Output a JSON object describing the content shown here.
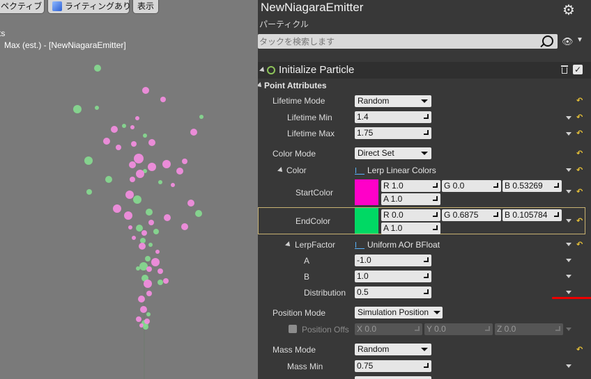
{
  "viewport": {
    "toolbar": {
      "perspective_label": "ペクティブ",
      "lighting_label": "ライティングあり",
      "show_label": "表示"
    },
    "stats_line1": "ts",
    "stats_line2": "Max (est.) - [NewNiagaraEmitter]",
    "particle_colors": {
      "pink": "#f38de0",
      "green": "#86d98f"
    }
  },
  "panel": {
    "title": "NewNiagaraEmitter",
    "subtitle": "パーティクル",
    "search": {
      "placeholder": "タックを検索します"
    },
    "module": {
      "title": "Initialize Particle",
      "section": "Point Attributes",
      "rows": {
        "lifetime_mode": {
          "label": "Lifetime Mode",
          "value": "Random"
        },
        "lifetime_min": {
          "label": "Lifetime Min",
          "value": "1.4"
        },
        "lifetime_max": {
          "label": "Lifetime Max",
          "value": "1.75"
        },
        "color_mode": {
          "label": "Color Mode",
          "value": "Direct Set"
        },
        "color": {
          "label": "Color",
          "value": "Lerp Linear Colors"
        },
        "start_color": {
          "label": "StartColor",
          "r": "R 1.0",
          "g": "G 0.0",
          "b": "B 0.53269",
          "a": "A 1.0",
          "swatch": "#ff00c8"
        },
        "end_color": {
          "label": "EndColor",
          "r": "R 0.0",
          "g": "G 0.6875",
          "b": "B 0.105784",
          "a": "A 1.0",
          "swatch": "#00d964"
        },
        "lerp_factor": {
          "label": "LerpFactor",
          "value": "Uniform AOr BFloat"
        },
        "a": {
          "label": "A",
          "value": "-1.0"
        },
        "b": {
          "label": "B",
          "value": "1.0"
        },
        "distribution": {
          "label": "Distribution",
          "value": "0.5"
        },
        "position_mode": {
          "label": "Position Mode",
          "value": "Simulation Position"
        },
        "position_offset": {
          "label": "Position Offs",
          "x": "X 0.0",
          "y": "Y 0.0",
          "z": "Z 0.0"
        },
        "mass_mode": {
          "label": "Mass Mode",
          "value": "Random"
        },
        "mass_min": {
          "label": "Mass Min",
          "value": "0.75"
        }
      }
    }
  }
}
